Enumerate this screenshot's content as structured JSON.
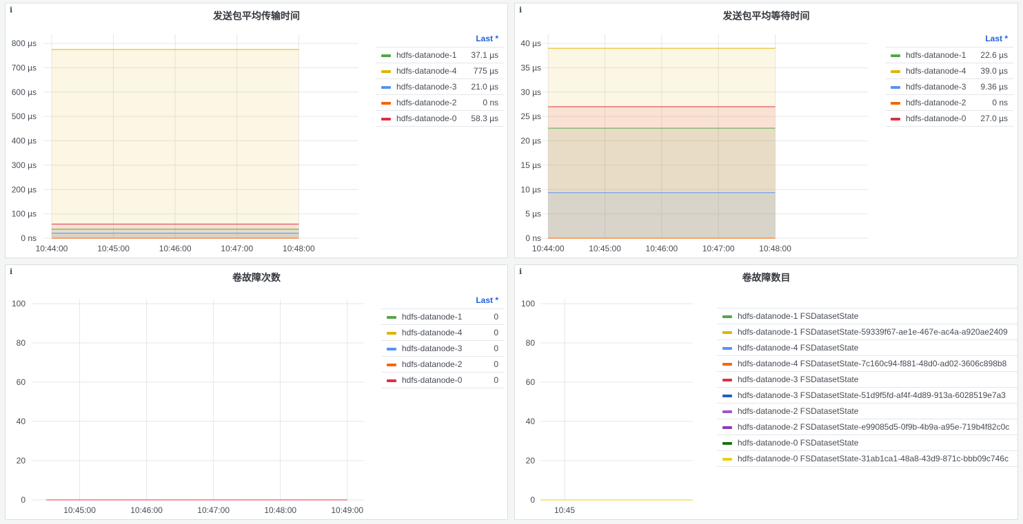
{
  "panels": [
    {
      "title": "发送包平均传输时间",
      "legend_header": "Last *",
      "y_ticks": [
        "0 ns",
        "100 µs",
        "200 µs",
        "300 µs",
        "400 µs",
        "500 µs",
        "600 µs",
        "700 µs",
        "800 µs"
      ],
      "x_ticks": [
        "10:44:00",
        "10:45:00",
        "10:46:00",
        "10:47:00",
        "10:48:00"
      ],
      "chart_data": {
        "type": "area",
        "unit": "µs",
        "ylim": [
          0,
          820
        ],
        "x": [
          "10:44:00",
          "10:48:00"
        ],
        "series": [
          {
            "name": "hdfs-datanode-1",
            "color": "#56a64b",
            "value": 37.1,
            "last": "37.1 µs"
          },
          {
            "name": "hdfs-datanode-4",
            "color": "#e0b400",
            "value": 775,
            "last": "775 µs"
          },
          {
            "name": "hdfs-datanode-3",
            "color": "#5794f2",
            "value": 21.0,
            "last": "21.0 µs"
          },
          {
            "name": "hdfs-datanode-2",
            "color": "#fa6400",
            "value": 0,
            "last": "0 ns"
          },
          {
            "name": "hdfs-datanode-0",
            "color": "#e02f44",
            "value": 58.3,
            "last": "58.3 µs"
          }
        ]
      }
    },
    {
      "title": "发送包平均等待时间",
      "legend_header": "Last *",
      "y_ticks": [
        "0 ns",
        "5 µs",
        "10 µs",
        "15 µs",
        "20 µs",
        "25 µs",
        "30 µs",
        "35 µs",
        "40 µs"
      ],
      "x_ticks": [
        "10:44:00",
        "10:45:00",
        "10:46:00",
        "10:47:00",
        "10:48:00"
      ],
      "chart_data": {
        "type": "area",
        "unit": "µs",
        "ylim": [
          0,
          41
        ],
        "x": [
          "10:44:00",
          "10:48:00"
        ],
        "series": [
          {
            "name": "hdfs-datanode-1",
            "color": "#56a64b",
            "value": 22.6,
            "last": "22.6 µs"
          },
          {
            "name": "hdfs-datanode-4",
            "color": "#e0b400",
            "value": 39.0,
            "last": "39.0 µs"
          },
          {
            "name": "hdfs-datanode-3",
            "color": "#5794f2",
            "value": 9.36,
            "last": "9.36 µs"
          },
          {
            "name": "hdfs-datanode-2",
            "color": "#fa6400",
            "value": 0,
            "last": "0 ns"
          },
          {
            "name": "hdfs-datanode-0",
            "color": "#e02f44",
            "value": 27.0,
            "last": "27.0 µs"
          }
        ]
      }
    },
    {
      "title": "卷故障次数",
      "legend_header": "Last *",
      "y_ticks": [
        "0",
        "20",
        "40",
        "60",
        "80",
        "100"
      ],
      "x_ticks": [
        "10:45:00",
        "10:46:00",
        "10:47:00",
        "10:48:00",
        "10:49:00"
      ],
      "chart_data": {
        "type": "line",
        "ylim": [
          0,
          100
        ],
        "x": [
          "10:44:30",
          "10:49:00"
        ],
        "series": [
          {
            "name": "hdfs-datanode-1",
            "color": "#56a64b",
            "value": 0,
            "last": "0"
          },
          {
            "name": "hdfs-datanode-4",
            "color": "#e0b400",
            "value": 0,
            "last": "0"
          },
          {
            "name": "hdfs-datanode-3",
            "color": "#5794f2",
            "value": 0,
            "last": "0"
          },
          {
            "name": "hdfs-datanode-2",
            "color": "#fa6400",
            "value": 0,
            "last": "0"
          },
          {
            "name": "hdfs-datanode-0",
            "color": "#e02f44",
            "value": 0,
            "last": "0"
          }
        ]
      }
    },
    {
      "title": "卷故障数目",
      "y_ticks": [
        "0",
        "20",
        "40",
        "60",
        "80",
        "100"
      ],
      "x_ticks": [
        "10:45"
      ],
      "chart_data": {
        "type": "line",
        "ylim": [
          0,
          100
        ],
        "series": [
          {
            "name": "hdfs-datanode-1 FSDatasetState",
            "color": "#56a64b",
            "value": 0
          },
          {
            "name": "hdfs-datanode-1 FSDatasetState-59339f67-ae1e-467e-ac4a-a920ae2409",
            "color": "#e0b400",
            "value": 0
          },
          {
            "name": "hdfs-datanode-4 FSDatasetState",
            "color": "#5794f2",
            "value": 0
          },
          {
            "name": "hdfs-datanode-4 FSDatasetState-7c160c94-f881-48d0-ad02-3606c898b8",
            "color": "#fa6400",
            "value": 0
          },
          {
            "name": "hdfs-datanode-3 FSDatasetState",
            "color": "#e02f44",
            "value": 0
          },
          {
            "name": "hdfs-datanode-3 FSDatasetState-51d9f5fd-af4f-4d89-913a-6028519e7a3",
            "color": "#1f60c4",
            "value": 0
          },
          {
            "name": "hdfs-datanode-2 FSDatasetState",
            "color": "#a352cc",
            "value": 0
          },
          {
            "name": "hdfs-datanode-2 FSDatasetState-e99085d5-0f9b-4b9a-a95e-719b4f82c0c",
            "color": "#8f3bb8",
            "value": 0
          },
          {
            "name": "hdfs-datanode-0 FSDatasetState",
            "color": "#19730e",
            "value": 0
          },
          {
            "name": "hdfs-datanode-0 FSDatasetState-31ab1ca1-48a8-43d9-871c-bbb09c746c",
            "color": "#f2cc0c",
            "value": 0
          }
        ]
      }
    }
  ]
}
